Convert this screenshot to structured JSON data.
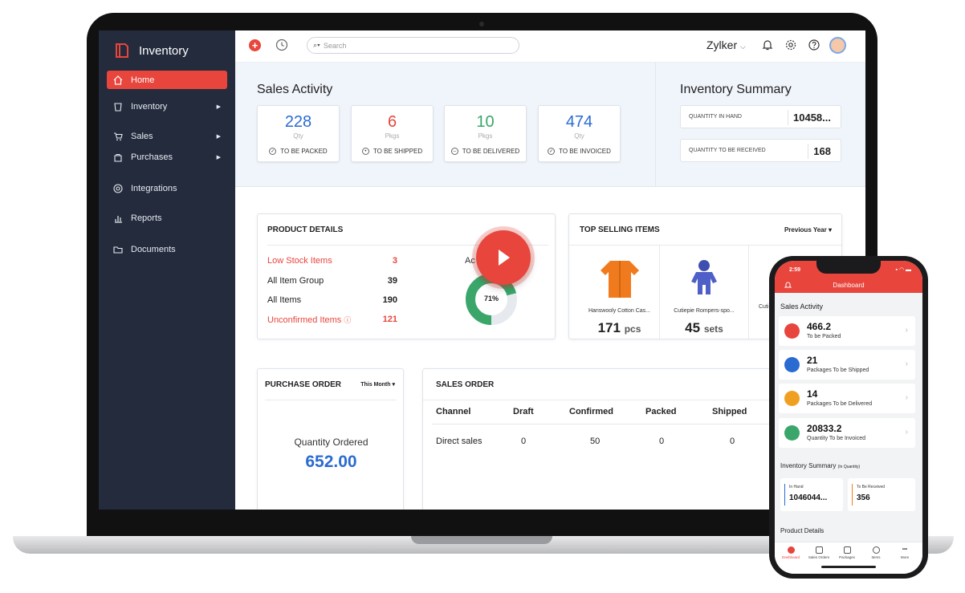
{
  "app": {
    "title": "Inventory"
  },
  "sidebar": {
    "items": [
      {
        "label": "Home",
        "icon": "home-icon"
      },
      {
        "label": "Inventory",
        "icon": "inventory-icon"
      },
      {
        "label": "Sales",
        "icon": "cart-icon"
      },
      {
        "label": "Purchases",
        "icon": "bag-icon"
      },
      {
        "label": "Integrations",
        "icon": "integrations-icon"
      },
      {
        "label": "Reports",
        "icon": "reports-icon"
      },
      {
        "label": "Documents",
        "icon": "folder-icon"
      }
    ]
  },
  "topbar": {
    "search_placeholder": "Search",
    "org_name": "Zylker"
  },
  "sales_activity": {
    "title": "Sales Activity",
    "stats": [
      {
        "value": "228",
        "unit": "Qty",
        "label": "TO BE PACKED",
        "color": "#2a6bd1"
      },
      {
        "value": "6",
        "unit": "Pkgs",
        "label": "TO BE SHIPPED",
        "color": "#e8453c"
      },
      {
        "value": "10",
        "unit": "Pkgs",
        "label": "TO BE DELIVERED",
        "color": "#3aa66a"
      },
      {
        "value": "474",
        "unit": "Qty",
        "label": "TO BE INVOICED",
        "color": "#2a6bd1"
      }
    ]
  },
  "inventory_summary": {
    "title": "Inventory Summary",
    "rows": [
      {
        "label": "QUANTITY IN HAND",
        "value": "10458..."
      },
      {
        "label": "QUANTITY TO BE RECEIVED",
        "value": "168"
      }
    ]
  },
  "product_details": {
    "title": "PRODUCT DETAILS",
    "rows": [
      {
        "label": "Low Stock Items",
        "value": "3"
      },
      {
        "label": "All Item Group",
        "value": "39"
      },
      {
        "label": "All Items",
        "value": "190"
      },
      {
        "label": "Unconfirmed Items",
        "value": "121"
      }
    ],
    "donut_label": "Ac",
    "donut_percent": "71%",
    "donut_fraction": 0.71
  },
  "top_selling": {
    "title": "TOP SELLING ITEMS",
    "filter": "Previous Year",
    "items": [
      {
        "name": "Hanswooly Cotton Cas...",
        "qty": "171",
        "unit": "pcs"
      },
      {
        "name": "Cutiepie Rompers-spo...",
        "qty": "45",
        "unit": "sets"
      },
      {
        "name": "Cuti"
      }
    ]
  },
  "purchase_order": {
    "title": "PURCHASE ORDER",
    "filter": "This Month",
    "label": "Quantity Ordered",
    "value": "652.00"
  },
  "sales_order": {
    "title": "SALES ORDER",
    "columns": [
      "Channel",
      "Draft",
      "Confirmed",
      "Packed",
      "Shipped"
    ],
    "row": [
      "Direct sales",
      "0",
      "50",
      "0",
      "0"
    ]
  },
  "phone": {
    "time": "2:59",
    "header": "Dashboard",
    "sales_activity_title": "Sales Activity",
    "cards": [
      {
        "value": "466.2",
        "label": "To be Packed",
        "color": "#e8453c"
      },
      {
        "value": "21",
        "label": "Packages To be Shipped",
        "color": "#2a6bd1"
      },
      {
        "value": "14",
        "label": "Packages To be Delivered",
        "color": "#f0a020"
      },
      {
        "value": "20833.2",
        "label": "Quantity To be Invoiced",
        "color": "#3aa66a"
      }
    ],
    "inv_title": "Inventory Summary",
    "inv_sub": "(In Quantity)",
    "in_hand_label": "In Hand",
    "in_hand_value": "1046044...",
    "to_receive_label": "To Be Received",
    "to_receive_value": "356",
    "product_details_title": "Product Details",
    "tabs": [
      "Dashboard",
      "Sales Orders",
      "Packages",
      "Items",
      "More"
    ]
  }
}
